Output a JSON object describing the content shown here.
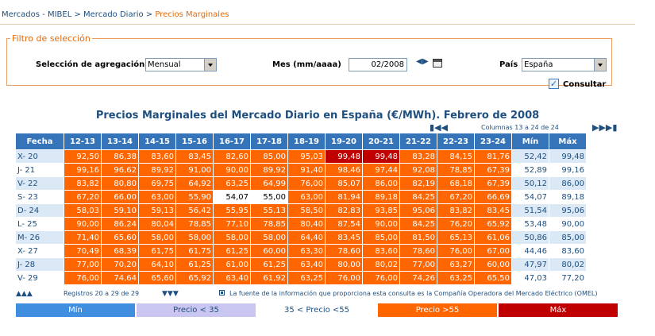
{
  "breadcrumb": {
    "part1": "Mercados - MIBEL",
    "sep": " > ",
    "part2": "Mercado Diario",
    "current": "Precios Marginales"
  },
  "filter": {
    "legend": "Filtro de selección",
    "agg_label": "Selección de agregación",
    "agg_value": "Mensual",
    "month_label": "Mes (mm/aaaa)",
    "month_value": "02/2008",
    "country_label": "País",
    "country_value": "España",
    "consult_label": "Consultar"
  },
  "table": {
    "title": "Precios Marginales del Mercado Diario en España (€/MWh). Febrero de 2008",
    "columns_info": "Columnas 13 a 24 de 24",
    "headers": [
      "Fecha",
      "12-13",
      "13-14",
      "14-15",
      "15-16",
      "16-17",
      "17-18",
      "18-19",
      "19-20",
      "20-21",
      "21-22",
      "22-23",
      "23-24",
      "Mín",
      "Máx"
    ],
    "rows": [
      {
        "fecha": "X- 20",
        "vals": [
          "92,50",
          "86,38",
          "83,60",
          "83,45",
          "82,60",
          "85,00",
          "95,03",
          "99,48",
          "99,48",
          "83,28",
          "84,15",
          "81,76"
        ],
        "cls": [
          "o",
          "o",
          "o",
          "o",
          "o",
          "o",
          "o",
          "r",
          "r",
          "o",
          "o",
          "o"
        ],
        "min": "52,42",
        "max": "99,48"
      },
      {
        "fecha": "J- 21",
        "vals": [
          "99,16",
          "96,62",
          "89,92",
          "91,00",
          "90,00",
          "89,92",
          "91,40",
          "98,46",
          "97,44",
          "92,08",
          "78,85",
          "67,39"
        ],
        "cls": [
          "o",
          "o",
          "o",
          "o",
          "o",
          "o",
          "o",
          "o",
          "o",
          "o",
          "o",
          "o"
        ],
        "min": "52,89",
        "max": "99,16"
      },
      {
        "fecha": "V- 22",
        "vals": [
          "83,82",
          "80,80",
          "69,75",
          "64,92",
          "63,25",
          "64,99",
          "76,00",
          "85,07",
          "86,00",
          "82,19",
          "68,18",
          "67,39"
        ],
        "cls": [
          "o",
          "o",
          "o",
          "o",
          "o",
          "o",
          "o",
          "o",
          "o",
          "o",
          "o",
          "o"
        ],
        "min": "50,12",
        "max": "86,00"
      },
      {
        "fecha": "S- 23",
        "vals": [
          "67,20",
          "66,00",
          "63,00",
          "55,90",
          "54,07",
          "55,00",
          "63,00",
          "81,94",
          "89,18",
          "84,25",
          "67,20",
          "66,69"
        ],
        "cls": [
          "o",
          "o",
          "o",
          "o",
          "w",
          "w",
          "o",
          "o",
          "o",
          "o",
          "o",
          "o"
        ],
        "min": "54,07",
        "max": "89,18"
      },
      {
        "fecha": "D- 24",
        "vals": [
          "58,03",
          "59,10",
          "59,13",
          "56,42",
          "55,95",
          "55,13",
          "58,50",
          "82,83",
          "93,85",
          "95,06",
          "83,82",
          "83,45"
        ],
        "cls": [
          "o",
          "o",
          "o",
          "o",
          "o",
          "o",
          "o",
          "o",
          "o",
          "o",
          "o",
          "o"
        ],
        "min": "51,54",
        "max": "95,06"
      },
      {
        "fecha": "L- 25",
        "vals": [
          "90,00",
          "86,24",
          "80,04",
          "78,85",
          "77,10",
          "78,85",
          "80,40",
          "87,54",
          "90,00",
          "84,25",
          "76,20",
          "65,92"
        ],
        "cls": [
          "o",
          "o",
          "o",
          "o",
          "o",
          "o",
          "o",
          "o",
          "o",
          "o",
          "o",
          "o"
        ],
        "min": "53,48",
        "max": "90,00"
      },
      {
        "fecha": "M- 26",
        "vals": [
          "71,40",
          "65,60",
          "58,00",
          "58,00",
          "58,00",
          "58,00",
          "64,40",
          "83,45",
          "85,00",
          "81,50",
          "65,13",
          "61,06"
        ],
        "cls": [
          "o",
          "o",
          "o",
          "o",
          "o",
          "o",
          "o",
          "o",
          "o",
          "o",
          "o",
          "o"
        ],
        "min": "50,86",
        "max": "85,00"
      },
      {
        "fecha": "X- 27",
        "vals": [
          "70,49",
          "68,39",
          "61,75",
          "61,75",
          "61,25",
          "60,00",
          "63,30",
          "78,60",
          "83,60",
          "78,60",
          "76,00",
          "67,00"
        ],
        "cls": [
          "o",
          "o",
          "o",
          "o",
          "o",
          "o",
          "o",
          "o",
          "o",
          "o",
          "o",
          "o"
        ],
        "min": "44,46",
        "max": "83,60"
      },
      {
        "fecha": "J- 28",
        "vals": [
          "77,00",
          "70,20",
          "64,10",
          "61,25",
          "61,00",
          "61,25",
          "63,40",
          "80,00",
          "80,02",
          "77,00",
          "63,27",
          "60,00"
        ],
        "cls": [
          "o",
          "o",
          "o",
          "o",
          "o",
          "o",
          "o",
          "o",
          "o",
          "o",
          "o",
          "o"
        ],
        "min": "47,97",
        "max": "80,02"
      },
      {
        "fecha": "V- 29",
        "vals": [
          "76,00",
          "74,64",
          "65,60",
          "65,92",
          "63,40",
          "61,92",
          "63,25",
          "76,00",
          "76,00",
          "74,26",
          "63,25",
          "65,50"
        ],
        "cls": [
          "o",
          "o",
          "o",
          "o",
          "o",
          "o",
          "o",
          "o",
          "o",
          "o",
          "o",
          "o"
        ],
        "min": "47,03",
        "max": "77,20"
      }
    ]
  },
  "footer": {
    "records": "Registros 20 a 29 de 29",
    "source": "La fuente de la información que proporciona esta consulta es la Compañía Operadora del Mercado Eléctrico (OMEL)"
  },
  "legend": {
    "min": "Mín",
    "low": "Precio < 35",
    "mid": "35 < Precio <55",
    "high": "Precio >55",
    "max": "Máx",
    "colors": {
      "min": "#3f8ee0",
      "low": "#c9c6f2",
      "mid": "#ffffff",
      "high": "#ff6600",
      "max": "#c00000"
    }
  },
  "icons": {
    "first": "first-page-icon",
    "prev": "prev-page-icon",
    "next": "next-page-icon",
    "last": "last-page-icon"
  }
}
